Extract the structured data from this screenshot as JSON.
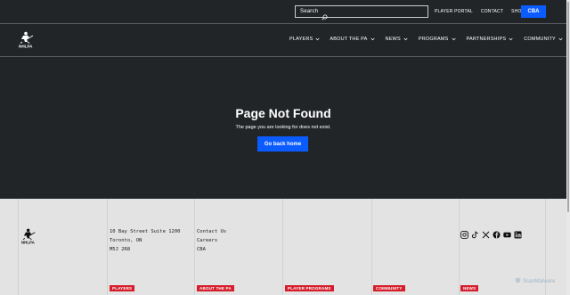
{
  "header": {
    "search_label": "Search",
    "utility_links": [
      "PLAYER PORTAL",
      "CONTACT",
      "SHOP"
    ],
    "cba_label": "CBA"
  },
  "nav": {
    "logo_text": "NHLPA",
    "items": [
      "PLAYERS",
      "ABOUT THE PA",
      "NEWS",
      "PROGRAMS",
      "PARTNERSHIPS",
      "COMMUNITY"
    ]
  },
  "main": {
    "title": "Page Not Found",
    "message": "The page you are looking for does not exist.",
    "button_label": "Go back home"
  },
  "footer": {
    "logo_text": "NHLPA",
    "address": [
      "10 Bay Street Suite 1200",
      "Toronto, ON",
      "M5J 2R8"
    ],
    "links": [
      "Contact Us",
      "Careers",
      "CBA"
    ],
    "socials": [
      "instagram-icon",
      "tiktok-icon",
      "x-icon",
      "facebook-icon",
      "youtube-icon",
      "linkedin-icon"
    ],
    "tags": [
      "PLAYERS",
      "ABOUT THE PA",
      "PLAYER PROGRAMS",
      "COMMUNITY",
      "NEWS"
    ],
    "watermark": "ScanMalware"
  },
  "colors": {
    "background": "#222528",
    "accent_blue": "#0b5cff",
    "tag_red": "#d51d2b",
    "footer_bg": "#e3e3e3"
  }
}
